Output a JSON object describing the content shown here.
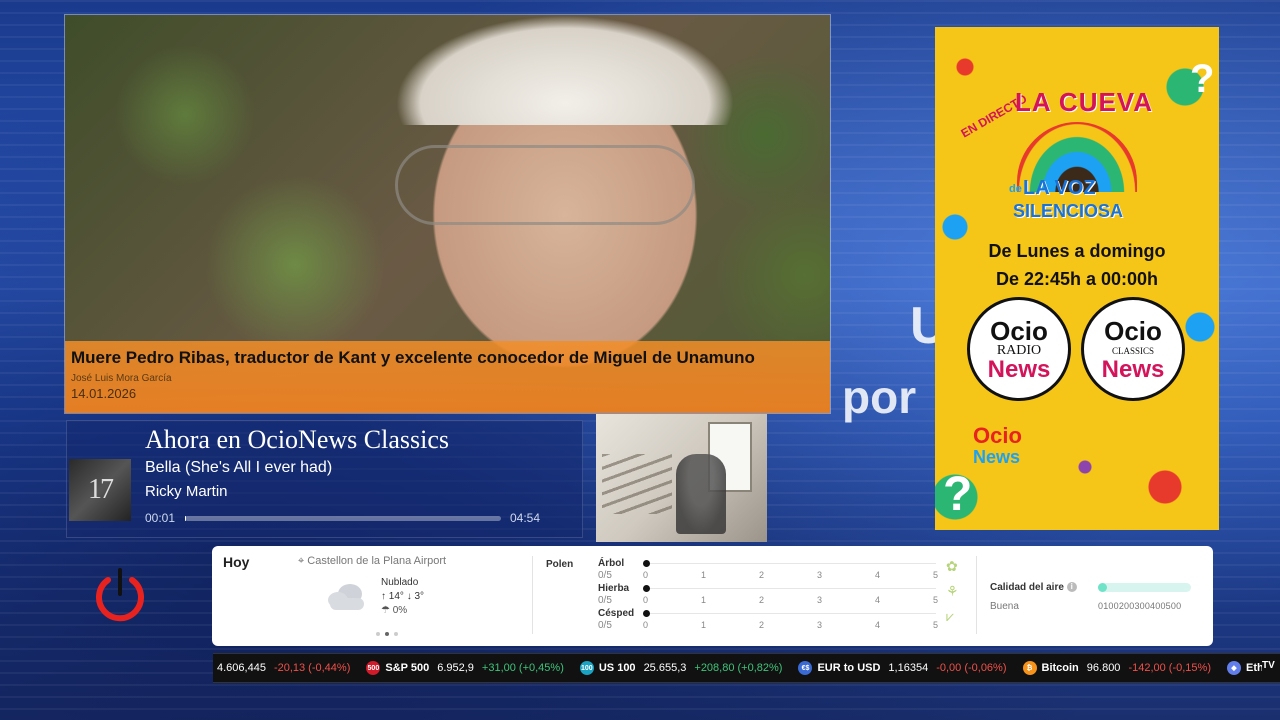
{
  "background": {
    "text_line1": "U",
    "text_line2": "por"
  },
  "news": {
    "headline": "Muere Pedro Ribas, traductor de Kant y excelente conocedor de Miguel de Unamuno",
    "author": "José Luis Mora García",
    "date": "14.01.2026",
    "accent_color": "#ec8023"
  },
  "now_playing": {
    "heading": "Ahora en OcioNews Classics",
    "cover_text": "17",
    "song": "Bella (She's All I ever had)",
    "artist": "Ricky Martin",
    "current_time": "00:01",
    "total_time": "04:54",
    "progress": 0.003
  },
  "promo": {
    "live": "EN DIRECTO",
    "title": "LA CUEVA",
    "de": "de",
    "subtitle1": "LA VOZ",
    "subtitle2": "SILENCIOSA",
    "schedule_days": "De Lunes a domingo",
    "schedule_hours": "De 22:45h a 00:00h",
    "logo1": {
      "top": "Ocio",
      "mid": "RADIO",
      "bottom": "News"
    },
    "logo2": {
      "top": "Ocio",
      "mid": "CLASSICS",
      "bottom": "News"
    },
    "small_logo": {
      "top": "Ocio",
      "bottom": "News"
    },
    "question_mark": "?",
    "bg_color": "#f5c518"
  },
  "weather": {
    "label": "Hoy",
    "location": "Castellon de la Plana Airport",
    "condition": "Nublado",
    "high": "↑ 14°",
    "low": "↓ 3°",
    "rain": "☂ 0%",
    "pollen_label": "Polen",
    "pollen": [
      {
        "name": "Árbol",
        "score": "0/5",
        "level": 0
      },
      {
        "name": "Hierba",
        "score": "0/5",
        "level": 0
      },
      {
        "name": "Césped",
        "score": "0/5",
        "level": 0
      }
    ],
    "scale_ticks": [
      "0",
      "1",
      "2",
      "3",
      "4",
      "5"
    ],
    "air_label": "Calidad del aire",
    "air_info": "i",
    "air_state": "Buena",
    "air_scale": "0100200300400500"
  },
  "ticker": [
    {
      "icon": "",
      "icon_color": "",
      "name": "",
      "value": "4.606,445",
      "change": "-20,13 (-0,44%)",
      "dir": "down"
    },
    {
      "icon": "500",
      "icon_color": "#d11a2a",
      "name": "S&P 500",
      "value": "6.952,9",
      "change": "+31,00 (+0,45%)",
      "dir": "up"
    },
    {
      "icon": "100",
      "icon_color": "#1aa3c2",
      "name": "US 100",
      "value": "25.655,3",
      "change": "+208,80 (+0,82%)",
      "dir": "up"
    },
    {
      "icon": "€$",
      "icon_color": "#3a6ad4",
      "name": "EUR to USD",
      "value": "1,16354",
      "change": "-0,00 (-0,06%)",
      "dir": "down"
    },
    {
      "icon": "₿",
      "icon_color": "#f7931a",
      "name": "Bitcoin",
      "value": "96.800",
      "change": "-142,00 (-0,15%)",
      "dir": "down"
    },
    {
      "icon": "◆",
      "icon_color": "#627eea",
      "name": "Ethe",
      "value": "",
      "change": "",
      "dir": "down"
    }
  ],
  "ticker_brand": "TV"
}
